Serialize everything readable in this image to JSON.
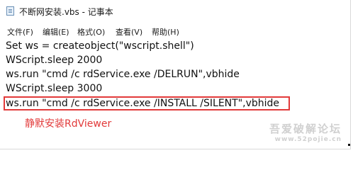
{
  "window": {
    "title": "不断网安装.vbs - 记事本",
    "icon": "notepad-icon"
  },
  "menu": [
    "文件(F)",
    "编辑(E)",
    "格式(O)",
    "查看(V)",
    "帮助(H)"
  ],
  "code_lines": [
    "Set ws = createobject(\"wscript.shell\")",
    "WScript.sleep 2000",
    "ws.run \"cmd /c rdService.exe /DELRUN\",vbhide",
    "WScript.sleep 3000",
    "ws.run \"cmd /c rdService.exe /INSTALL /SILENT\",vbhide"
  ],
  "annotation": "静默安装RdViewer",
  "watermark": {
    "main": "吾爱破解论坛",
    "sub": "www.52pojie.cn"
  },
  "colors": {
    "annotation": "#e23a3a",
    "highlight": "#e23a3a"
  }
}
